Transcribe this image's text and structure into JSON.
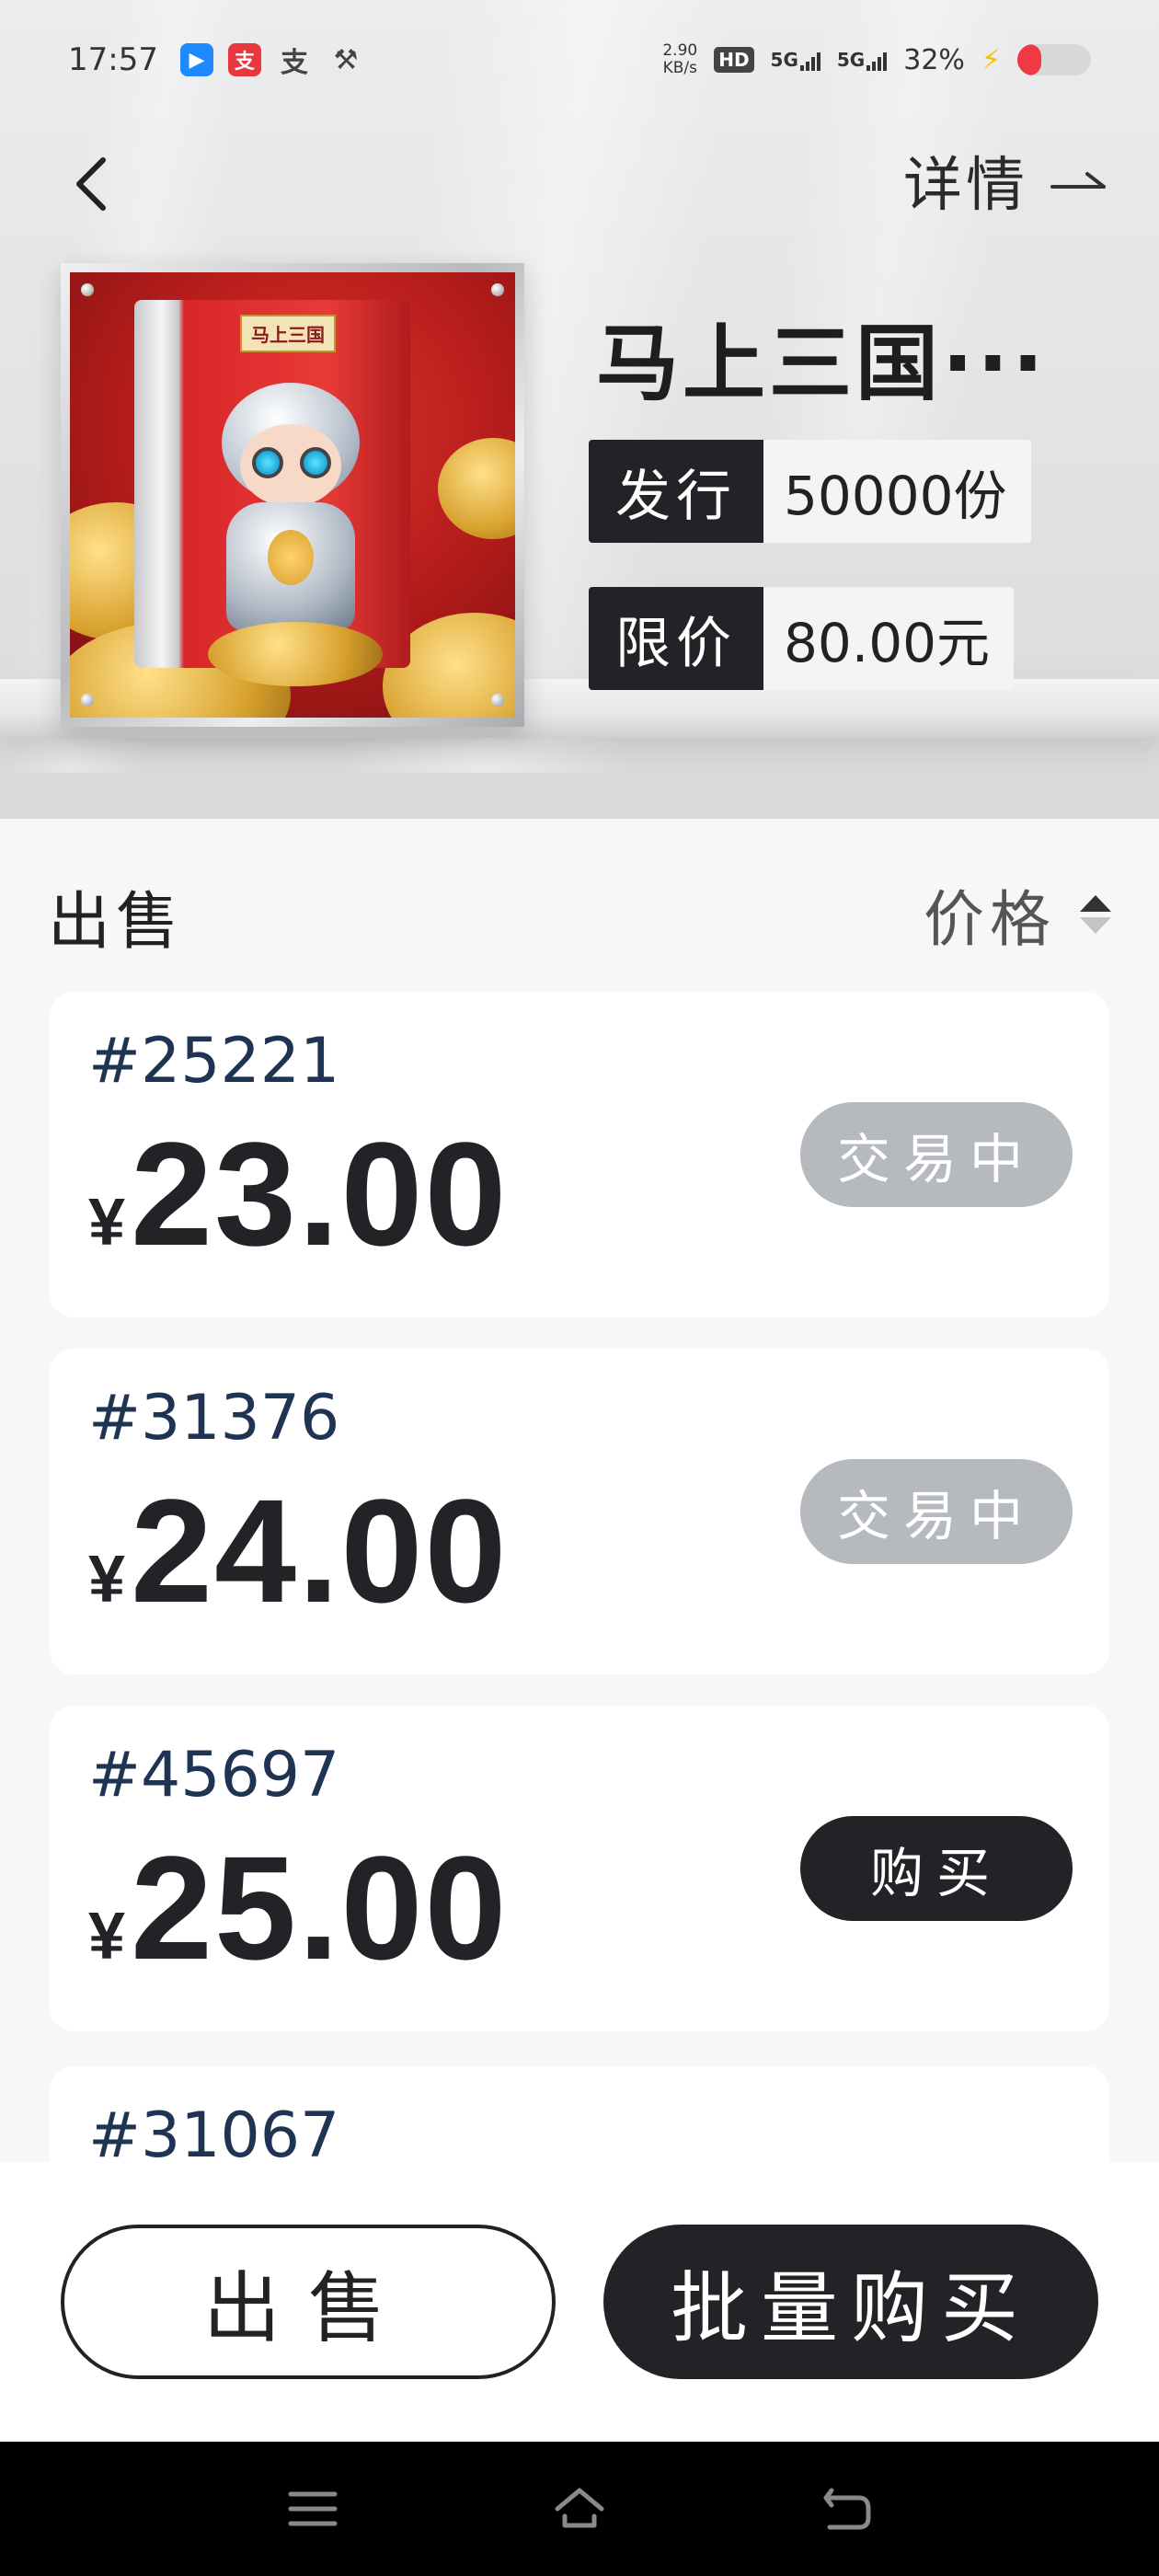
{
  "status_bar": {
    "time": "17:57",
    "network_speed_value": "2.90",
    "network_speed_unit": "KB/s",
    "hd_label": "HD",
    "hd_sub": "1",
    "hd_sub2": "2",
    "signal1": "5G",
    "signal2": "5G",
    "battery_percent": "32%",
    "battery_level": 0.32,
    "icons": [
      "app-blue-icon",
      "alipay-icon",
      "pay-glyph-icon",
      "tools-icon",
      "charging-bolt-icon"
    ]
  },
  "nav": {
    "detail_label": "详情"
  },
  "product": {
    "title": "马上三国···",
    "box_label": "马上三国",
    "tags": [
      {
        "key": "发行",
        "value": "50000份"
      },
      {
        "key": "限价",
        "value": "80.00元"
      }
    ]
  },
  "listing": {
    "title": "出售",
    "sort_label": "价格",
    "currency": "¥",
    "items": [
      {
        "number": "#25221",
        "price": "23.00",
        "action": "交易中"
      },
      {
        "number": "#31376",
        "price": "24.00",
        "action": "交易中"
      },
      {
        "number": "#45697",
        "price": "25.00",
        "action": "购买"
      },
      {
        "number": "#31067",
        "price": "",
        "action": ""
      }
    ]
  },
  "actions": {
    "sell_label": "出售",
    "bulk_buy_label": "批量购买"
  },
  "colors": {
    "dark": "#222326",
    "pending": "#b6b9be",
    "number_text": "#1f3452",
    "battery_red": "#ef3a45"
  }
}
